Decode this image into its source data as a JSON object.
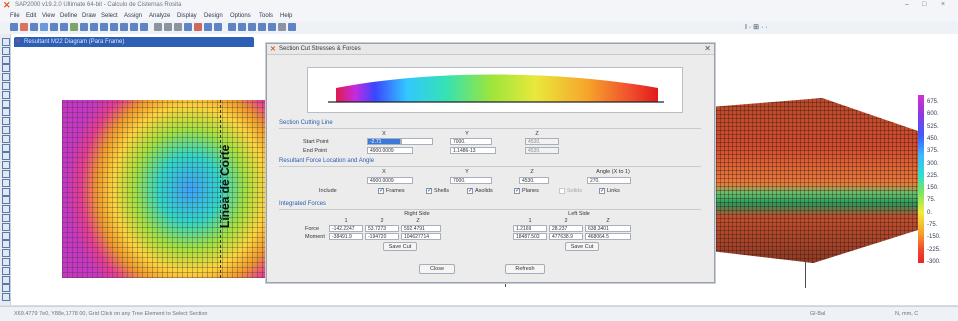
{
  "window": {
    "title": "SAP2000 v19.2.0 Ultimate 64-bit - Calculo de Cisternas Rosita",
    "controls": [
      "–",
      "□",
      "×"
    ]
  },
  "menu": [
    "File",
    "Edit",
    "View",
    "Define",
    "Draw",
    "Select",
    "Assign",
    "Analyze",
    "Display",
    "Design",
    "Options",
    "Tools",
    "Help"
  ],
  "toolbar": {
    "text_right": "I · ⊞ · ·",
    "icon_colors": [
      "#2d5fb5",
      "#d14a2b",
      "#2d5fb5",
      "#3b7bd1",
      "#2d5fb5",
      "#2d5fb5",
      "#5a8a3a",
      "#2d5fb5",
      "#2d5fb5",
      "#2d5fb5",
      "#2d5fb5",
      "#2d5fb5",
      "#2d5fb5",
      "#2d5fb5",
      "#6b7486",
      "#6b7486",
      "#6b7486",
      "#2d5fb5",
      "#c33a2a",
      "#2d5fb5",
      "#2d5fb5",
      "#2d5fb5",
      "#2d5fb5",
      "#2d5fb5",
      "#2d5fb5",
      "#2d5fb5",
      "#6b7486",
      "#2d5fb5"
    ]
  },
  "view_tab": {
    "label": "Resultant M22 Diagram  (Para Frame)"
  },
  "annotation": {
    "cut_label": "Línea de Corte"
  },
  "scale": {
    "labels": [
      "675.",
      "600.",
      "525.",
      "450.",
      "375.",
      "300.",
      "225.",
      "150.",
      "75.",
      "0.",
      "-75.",
      "-150.",
      "-225.",
      "-300."
    ]
  },
  "dialog": {
    "title": "Section Cut Stresses & Forces",
    "section_cutting_line": {
      "heading": "Section Cutting Line",
      "col_headers": [
        "X",
        "Y",
        "Z"
      ],
      "rows": [
        {
          "label": "Start Point",
          "values": [
            "-2.71",
            "7000.",
            "4530."
          ]
        },
        {
          "label": "End Point",
          "values": [
            "4900.0009",
            "1.1486-13",
            "4530."
          ]
        }
      ]
    },
    "resultant": {
      "heading": "Resultant Force Location and Angle",
      "col_headers": [
        "X",
        "Y",
        "Z",
        "Angle (X to 1)"
      ],
      "values": [
        "4900.0009",
        "7000.",
        "4530.",
        "270."
      ],
      "include_label": "Include",
      "checks": [
        {
          "label": "Frames",
          "checked": true
        },
        {
          "label": "Shells",
          "checked": true
        },
        {
          "label": "Asolids",
          "checked": true
        },
        {
          "label": "Planes",
          "checked": true
        },
        {
          "label": "Solids",
          "checked": false
        },
        {
          "label": "Links",
          "checked": true
        }
      ]
    },
    "integrated": {
      "heading": "Integrated Forces",
      "right_side": "Right Side",
      "left_side": "Left Side",
      "col_headers": [
        "1",
        "2",
        "Z",
        "1",
        "2",
        "Z"
      ],
      "rows": [
        {
          "label": "Force",
          "values": [
            "-142.2247",
            "53.7273",
            "592.4791",
            "1.2169",
            "28.237",
            "638.3401"
          ]
        },
        {
          "label": "Moment",
          "values": [
            "-38491.9",
            "-194720",
            "104627714",
            "18487.502",
            "477638.9",
            "468064.5"
          ]
        }
      ],
      "save_cut_right": "Save Cut",
      "save_cut_left": "Save Cut"
    },
    "buttons": {
      "close": "Close",
      "refresh": "Refresh"
    }
  },
  "status": {
    "text": "X69.4779 7e0, Y88e,1778 00, Grid Click on any Tree Element to Select Section",
    "units": "Gl-Bal",
    "units2": "N, mm, C"
  }
}
